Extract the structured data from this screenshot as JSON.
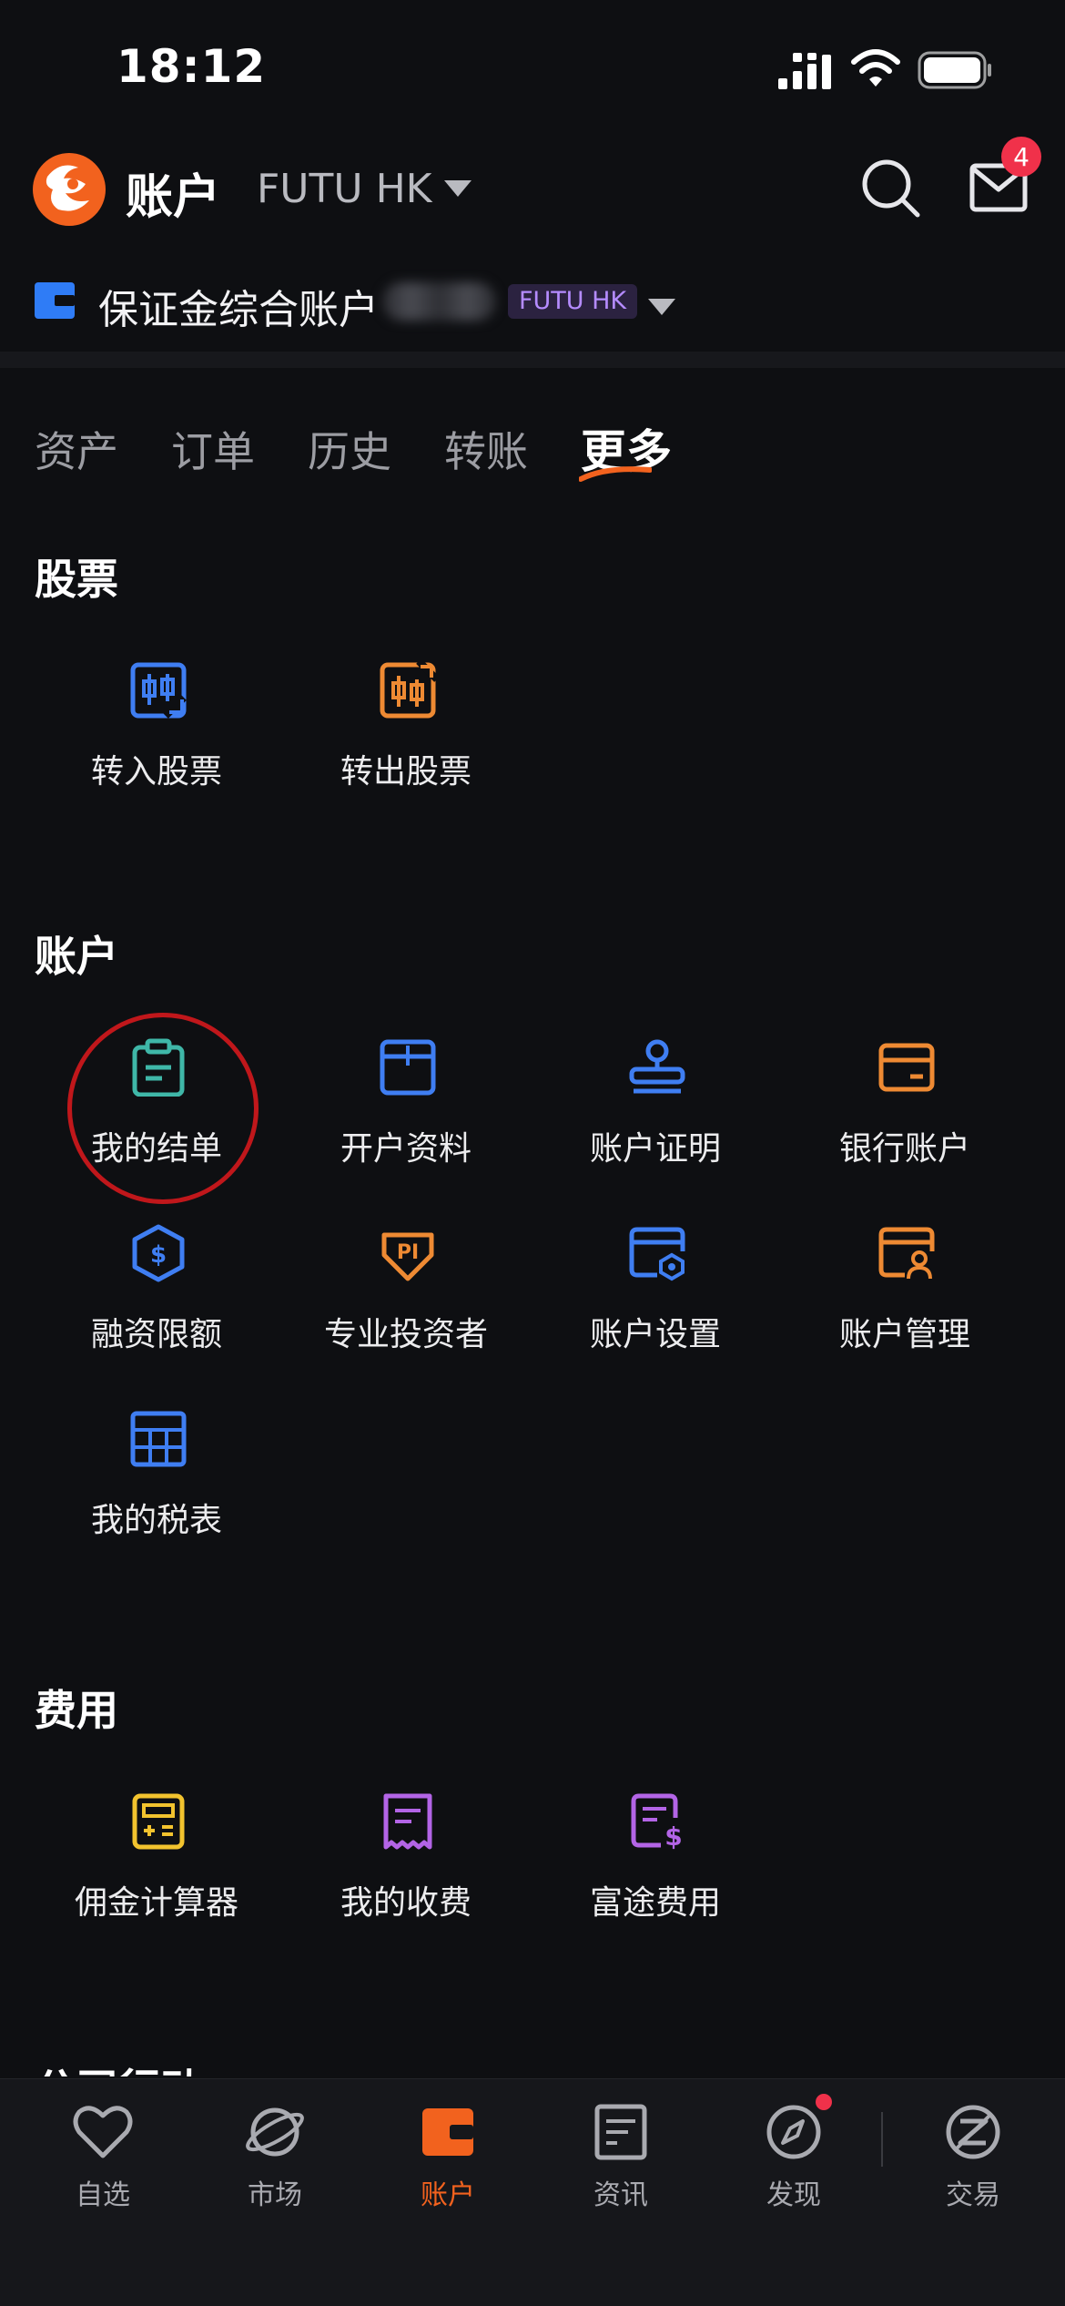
{
  "status_bar": {
    "time": "18:12"
  },
  "header": {
    "title": "账户",
    "broker": "FUTU HK",
    "mail_badge": "4"
  },
  "account": {
    "name": "保证金综合账户",
    "tag": "FUTU HK"
  },
  "tabs": [
    {
      "label": "资产"
    },
    {
      "label": "订单"
    },
    {
      "label": "历史"
    },
    {
      "label": "转账"
    },
    {
      "label": "更多"
    }
  ],
  "sections": {
    "stocks": {
      "title": "股票",
      "items": [
        {
          "label": "转入股票",
          "icon": "candlestick-in-icon"
        },
        {
          "label": "转出股票",
          "icon": "candlestick-out-icon"
        }
      ]
    },
    "account": {
      "title": "账户",
      "items": [
        {
          "label": "我的结单",
          "icon": "clipboard-icon"
        },
        {
          "label": "开户资料",
          "icon": "folder-doc-icon"
        },
        {
          "label": "账户证明",
          "icon": "stamp-icon"
        },
        {
          "label": "银行账户",
          "icon": "bank-card-icon"
        },
        {
          "label": "融资限额",
          "icon": "dollar-shield-icon"
        },
        {
          "label": "专业投资者",
          "icon": "pi-badge-icon"
        },
        {
          "label": "账户设置",
          "icon": "account-settings-icon"
        },
        {
          "label": "账户管理",
          "icon": "account-manage-icon"
        },
        {
          "label": "我的税表",
          "icon": "tax-table-icon"
        }
      ]
    },
    "fees": {
      "title": "费用",
      "items": [
        {
          "label": "佣金计算器",
          "icon": "calculator-icon"
        },
        {
          "label": "我的收费",
          "icon": "receipt-icon"
        },
        {
          "label": "富途费用",
          "icon": "fee-doc-icon"
        }
      ]
    },
    "corporate": {
      "title": "公司行动"
    }
  },
  "bottom_nav": [
    {
      "label": "自选",
      "icon": "heart-icon"
    },
    {
      "label": "市场",
      "icon": "planet-icon"
    },
    {
      "label": "账户",
      "icon": "wallet-icon"
    },
    {
      "label": "资讯",
      "icon": "news-icon"
    },
    {
      "label": "发现",
      "icon": "compass-icon"
    },
    {
      "label": "交易",
      "icon": "trade-icon"
    }
  ],
  "colors": {
    "accent": "#f2621e",
    "blue": "#3f7ef2",
    "orange": "#ee8a33",
    "teal": "#3fb7a8",
    "purple": "#b364e6",
    "yellow": "#f2c32e",
    "badge": "#f0314a",
    "background": "#0e0f12"
  }
}
